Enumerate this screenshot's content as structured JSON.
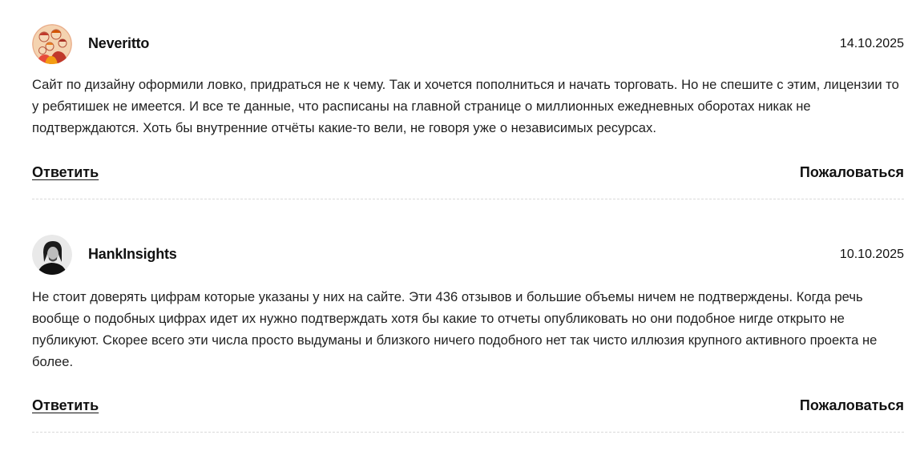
{
  "comments": [
    {
      "username": "Neveritto",
      "date": "14.10.2025",
      "text": "Сайт по дизайну оформили ловко, придраться не к чему. Так и хочется пополниться и начать торговать. Но не спешите с этим, лицензии то у ребятишек не имеется. И все те данные, что расписаны на главной странице о миллионных ежедневных оборотах никак не подтверждаются. Хоть бы внутренние отчёты какие-то вели, не говоря уже о независимых ресурсах.",
      "reply_label": "Ответить",
      "report_label": "Пожаловаться",
      "avatar_icon": "illustrated-family-avatar"
    },
    {
      "username": "HankInsights",
      "date": "10.10.2025",
      "text": "Не стоит доверять цифрам которые указаны у них на сайте. Эти 436 отзывов и большие объемы ничем не подтверждены. Когда речь вообще о подобных цифрах идет их нужно подтверждать хотя бы какие то отчеты опубликовать но они подобное нигде открыто не публикуют. Скорее всего эти числа просто выдуманы и близкого ничего подобного нет так чисто иллюзия крупного активного проекта не более.",
      "reply_label": "Ответить",
      "report_label": "Пожаловаться",
      "avatar_icon": "bw-portrait-avatar"
    }
  ]
}
